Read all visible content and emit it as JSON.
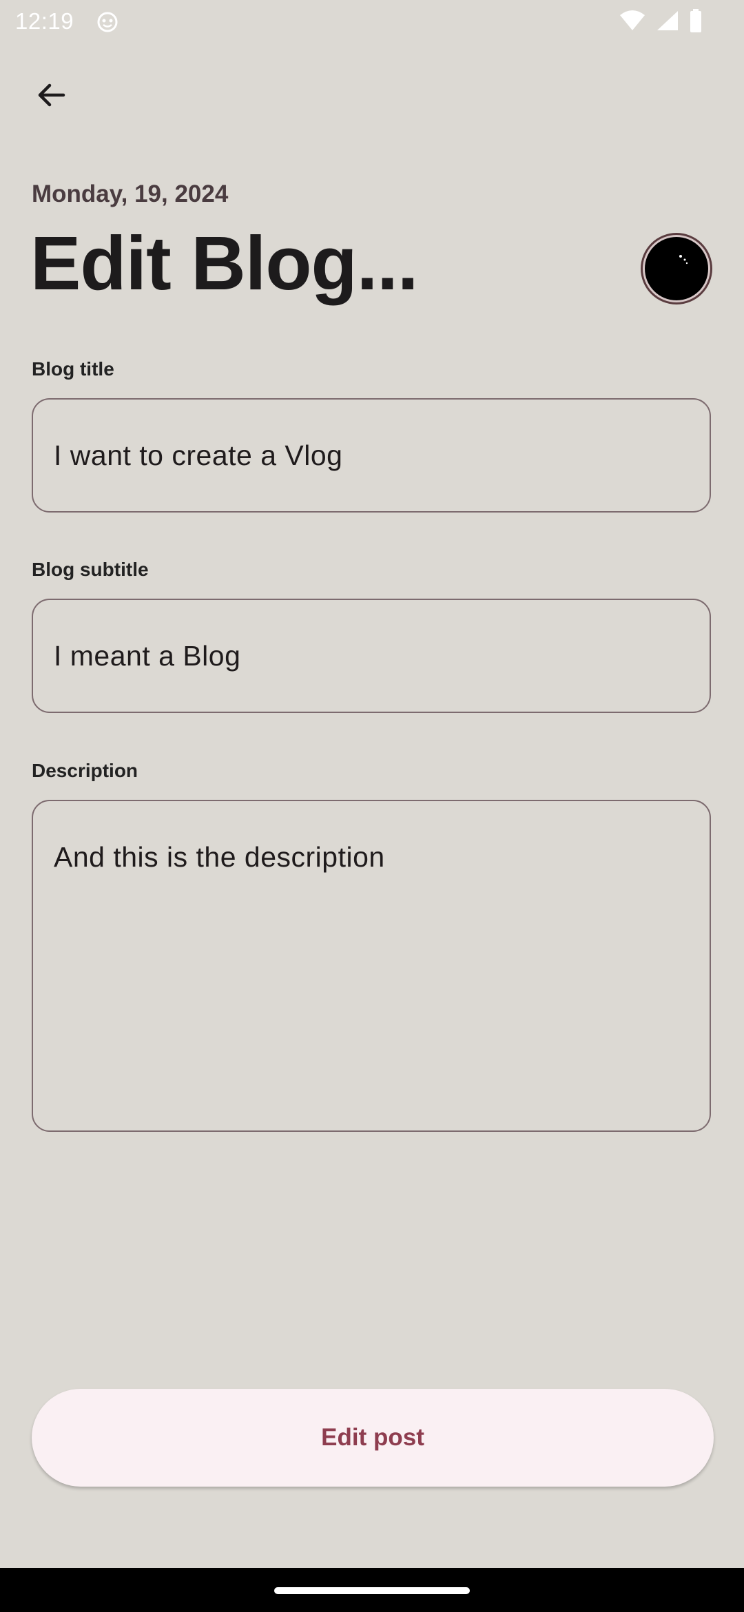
{
  "status_bar": {
    "time": "12:19",
    "icons": [
      "app-notification-icon",
      "wifi-icon",
      "cell-signal-icon",
      "battery-icon"
    ]
  },
  "header": {
    "back_icon": "arrow-back-icon",
    "date": "Monday, 19, 2024",
    "title": "Edit Blog..."
  },
  "form": {
    "title_label": "Blog title",
    "title_value": "I want to create a Vlog",
    "subtitle_label": "Blog subtitle",
    "subtitle_value": "I meant a Blog",
    "description_label": "Description",
    "description_value": "And this is the description"
  },
  "actions": {
    "edit_label": "Edit post"
  },
  "colors": {
    "background": "#dcd9d3",
    "accent_text": "#8e3d4f",
    "button_bg": "#faf0f3",
    "border": "#7d6b6f"
  }
}
